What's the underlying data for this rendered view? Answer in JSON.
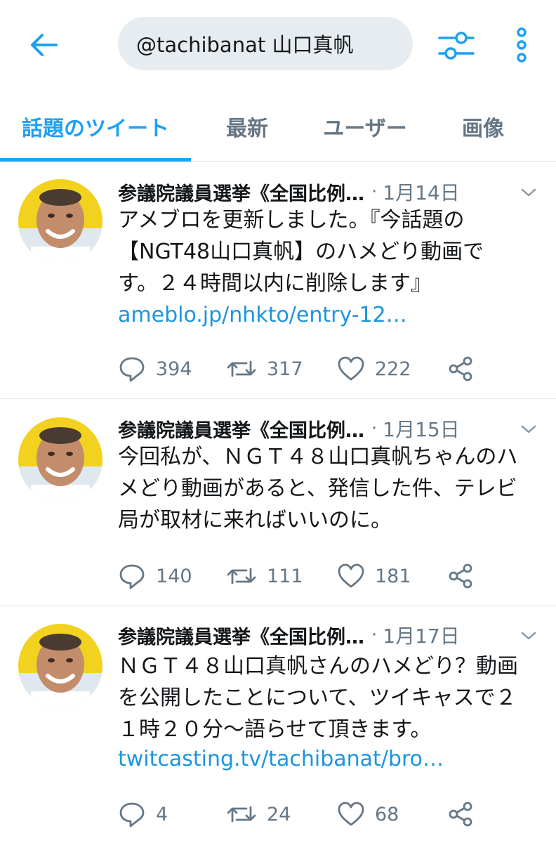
{
  "search": {
    "query": "@tachibanat 山口真帆"
  },
  "tabs": [
    {
      "label": "話題のツイート"
    },
    {
      "label": "最新"
    },
    {
      "label": "ユーザー"
    },
    {
      "label": "画像"
    }
  ],
  "colors": {
    "accent": "#1da1f2",
    "link": "#1b95e0",
    "muted": "#657786"
  },
  "tweets": [
    {
      "author": "参議院議員選挙《全国比例…",
      "dot": "·",
      "date": "1月14日",
      "lines": [
        "アメブロを更新しました。『今話題の",
        "【NGT48山口真帆】のハメどり動画で",
        "す。２４時間以内に削除します』"
      ],
      "link": "ameblo.jp/nhkto/entry-12…",
      "replies": "394",
      "retweets": "317",
      "likes": "222"
    },
    {
      "author": "参議院議員選挙《全国比例…",
      "dot": "·",
      "date": "1月15日",
      "lines": [
        "今回私が、ＮＧＴ４８山口真帆ちゃんのハ",
        "メどり動画があると、発信した件、テレビ",
        "局が取材に来ればいいのに。"
      ],
      "replies": "140",
      "retweets": "111",
      "likes": "181"
    },
    {
      "author": "参議院議員選挙《全国比例…",
      "dot": "·",
      "date": "1月17日",
      "lines": [
        "ＮＧＴ４８山口真帆さんのハメどり？動画",
        "を公開したことについて、ツイキャスで２",
        "１時２０分～語らせて頂きます。"
      ],
      "link": "twitcasting.tv/tachibanat/bro…",
      "replies": "4",
      "retweets": "24",
      "likes": "68"
    }
  ]
}
